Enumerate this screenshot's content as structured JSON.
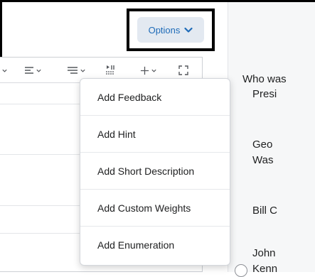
{
  "header": {
    "options_label": "Options"
  },
  "options_menu": {
    "items": [
      {
        "label": "Add Feedback"
      },
      {
        "label": "Add Hint"
      },
      {
        "label": "Add Short Description"
      },
      {
        "label": "Add Custom Weights"
      },
      {
        "label": "Add Enumeration"
      }
    ]
  },
  "question_preview": {
    "line1": "Who was",
    "line2": "Presi",
    "choice1_line1": "Geo",
    "choice1_line2": "Was",
    "choice2": "Bill C",
    "choice3_line1": "John",
    "choice3_line2": "Kenn"
  },
  "toolbar": {
    "icons": [
      "chevron-down-icon",
      "align-icon",
      "list-icon",
      "special-char-icon",
      "insert-plus-icon",
      "fullscreen-icon"
    ]
  },
  "colors": {
    "accent": "#1e6bb8",
    "button_bg": "#e3e9f1",
    "highlight_border": "#000000"
  }
}
